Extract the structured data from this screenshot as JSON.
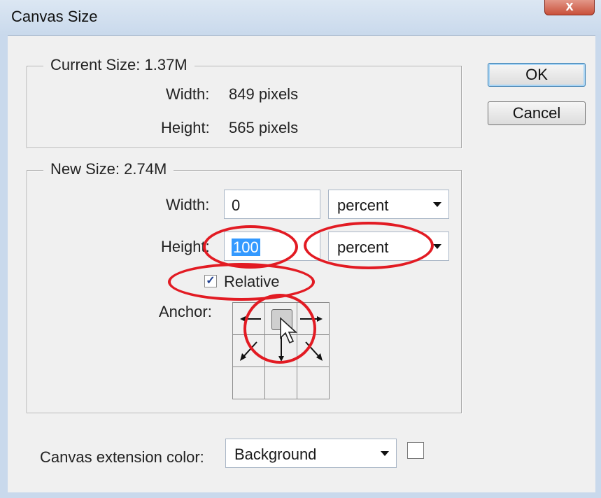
{
  "window": {
    "title": "Canvas Size",
    "close_label": "x"
  },
  "current_size": {
    "legend": "Current Size: 1.37M",
    "width_label": "Width:",
    "width_value": "849 pixels",
    "height_label": "Height:",
    "height_value": "565 pixels"
  },
  "new_size": {
    "legend": "New Size: 2.74M",
    "width_label": "Width:",
    "width_value": "0",
    "width_unit": "percent",
    "height_label": "Height:",
    "height_value": "100",
    "height_unit": "percent",
    "relative_label": "Relative",
    "relative_checked": true,
    "anchor_label": "Anchor:"
  },
  "extension": {
    "label": "Canvas extension color:",
    "value": "Background",
    "swatch_color": "#ffffff"
  },
  "buttons": {
    "ok": "OK",
    "cancel": "Cancel"
  },
  "annotation_color": "#e21b23",
  "icons": [
    "close-icon",
    "dropdown-arrow-icon",
    "checkmark-icon",
    "anchor-arrow-icon",
    "mouse-cursor-icon"
  ]
}
